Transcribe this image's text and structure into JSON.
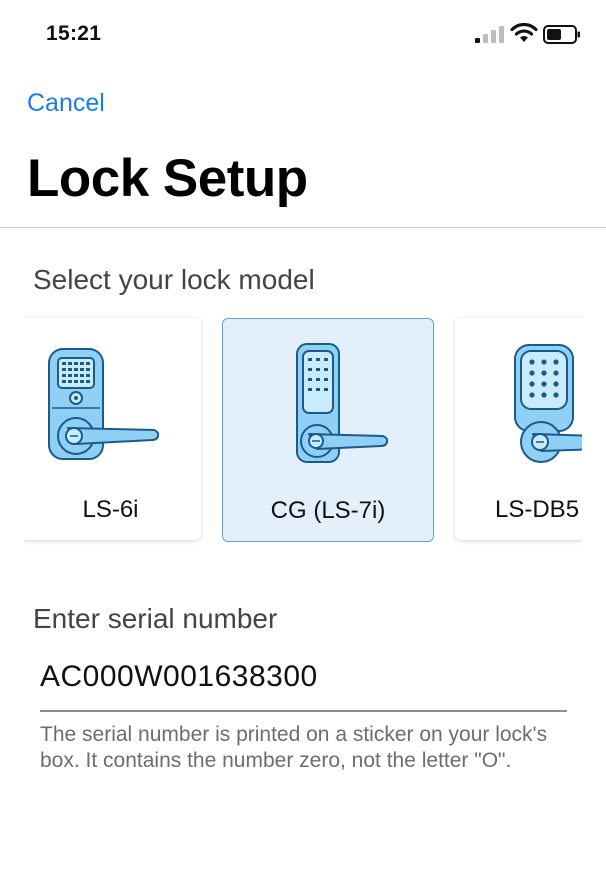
{
  "status_bar": {
    "time": "15:21"
  },
  "nav": {
    "cancel_label": "Cancel"
  },
  "page": {
    "title": "Lock Setup"
  },
  "model_section": {
    "label": "Select your lock model",
    "models": [
      {
        "name": "LS-6i",
        "selected": false
      },
      {
        "name": "CG (LS-7i)",
        "selected": true
      },
      {
        "name": "LS-DB5",
        "selected": false
      }
    ]
  },
  "serial_section": {
    "label": "Enter serial number",
    "value": "AC000W001638300",
    "help": "The serial number is printed on a sticker on your lock's box. It contains the number zero, not the letter \"O\"."
  },
  "colors": {
    "accent": "#1a7ee8",
    "selected_bg": "#e3f0fb",
    "check": "#1fae5b",
    "lock_fill": "#8fd0f4",
    "lock_stroke": "#1a5b8c"
  }
}
